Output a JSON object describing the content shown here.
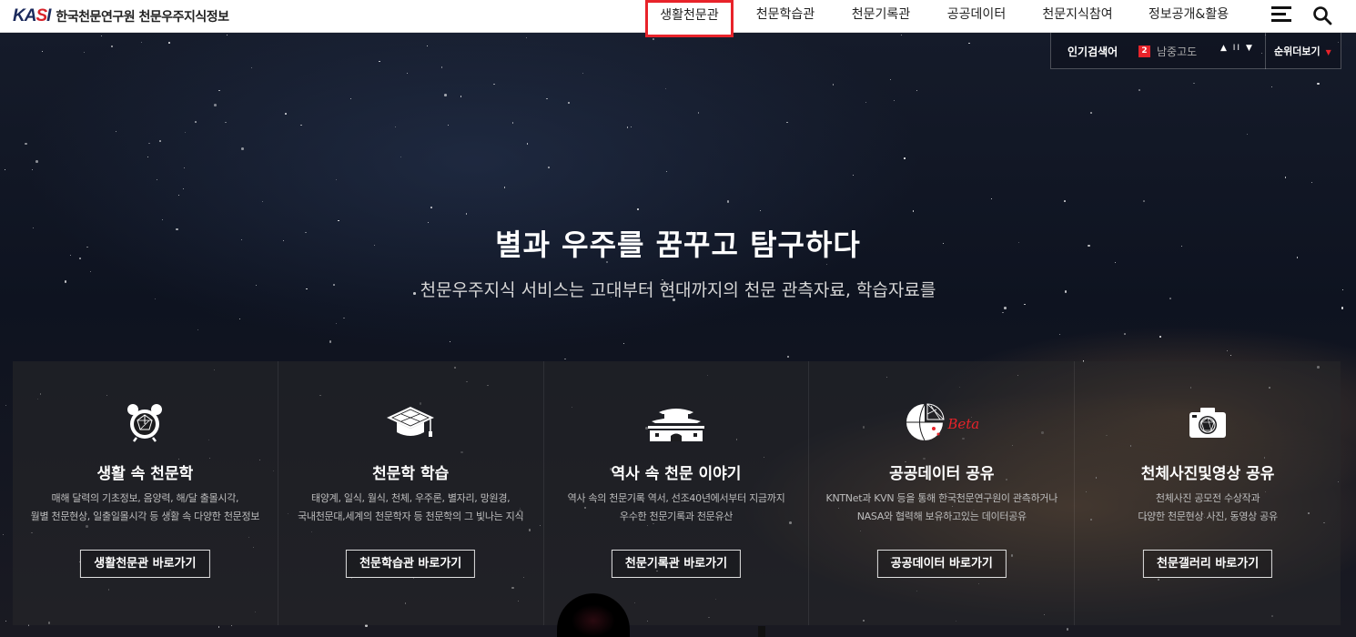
{
  "header": {
    "logo_mark": "KASI",
    "logo_text": "한국천문연구원 천문우주지식정보",
    "nav": [
      {
        "label": "생활천문관",
        "active": true
      },
      {
        "label": "천문학습관",
        "active": false
      },
      {
        "label": "천문기록관",
        "active": false
      },
      {
        "label": "공공데이터",
        "active": false
      },
      {
        "label": "천문지식참여",
        "active": false
      },
      {
        "label": "정보공개&활용",
        "active": false
      }
    ],
    "menu_icon": "hamburger-menu-icon",
    "search_icon": "search-icon",
    "active_color": "#e8232a"
  },
  "popular": {
    "label": "인기검색어",
    "rank": "2",
    "keyword": "남중고도",
    "controls": "▲ II ▼",
    "more_label": "순위더보기",
    "more_arrow": "▼"
  },
  "hero": {
    "title": "별과 우주를 꿈꾸고 탐구하다",
    "subtitle": "천문우주지식 서비스는 고대부터 현대까지의 천문 관측자료, 학습자료를"
  },
  "cards": [
    {
      "icon": "alarm-clock-icon",
      "title": "생활 속 천문학",
      "desc1": "매해 달력의 기초정보, 음양력, 해/달 출몰시각,",
      "desc2": "월별 천문현상, 일출일몰시각 등 생활 속 다양한 천문정보",
      "button": "생활천문관 바로가기"
    },
    {
      "icon": "graduation-cap-icon",
      "title": "천문학 학습",
      "desc1": "태양계, 일식, 월식, 천체, 우주론, 별자리, 망원경,",
      "desc2": "국내천문대,세계의 천문학자 등 천문학의 그 빛나는 지식",
      "button": "천문학습관 바로가기"
    },
    {
      "icon": "palace-gate-icon",
      "title": "역사 속 천문 이야기",
      "desc1": "역사 속의 천문기록 역서, 선조40년에서부터 지금까지",
      "desc2": "우수한 천문기록과 천문유산",
      "button": "천문기록관 바로가기"
    },
    {
      "icon": "data-globe-icon",
      "title": "공공데이터 공유",
      "beta": "Beta",
      "desc1": "KNTNet과 KVN 등을 통해 한국천문연구원이 관측하거나",
      "desc2": "NASA와 협력해 보유하고있는 데이터공유",
      "button": "공공데이터 바로가기"
    },
    {
      "icon": "camera-icon",
      "title": "천체사진및영상 공유",
      "desc1": "천체사진 공모전 수상작과",
      "desc2": "다양한 천문현상 사진, 동영상 공유",
      "button": "천문갤러리 바로가기"
    }
  ]
}
